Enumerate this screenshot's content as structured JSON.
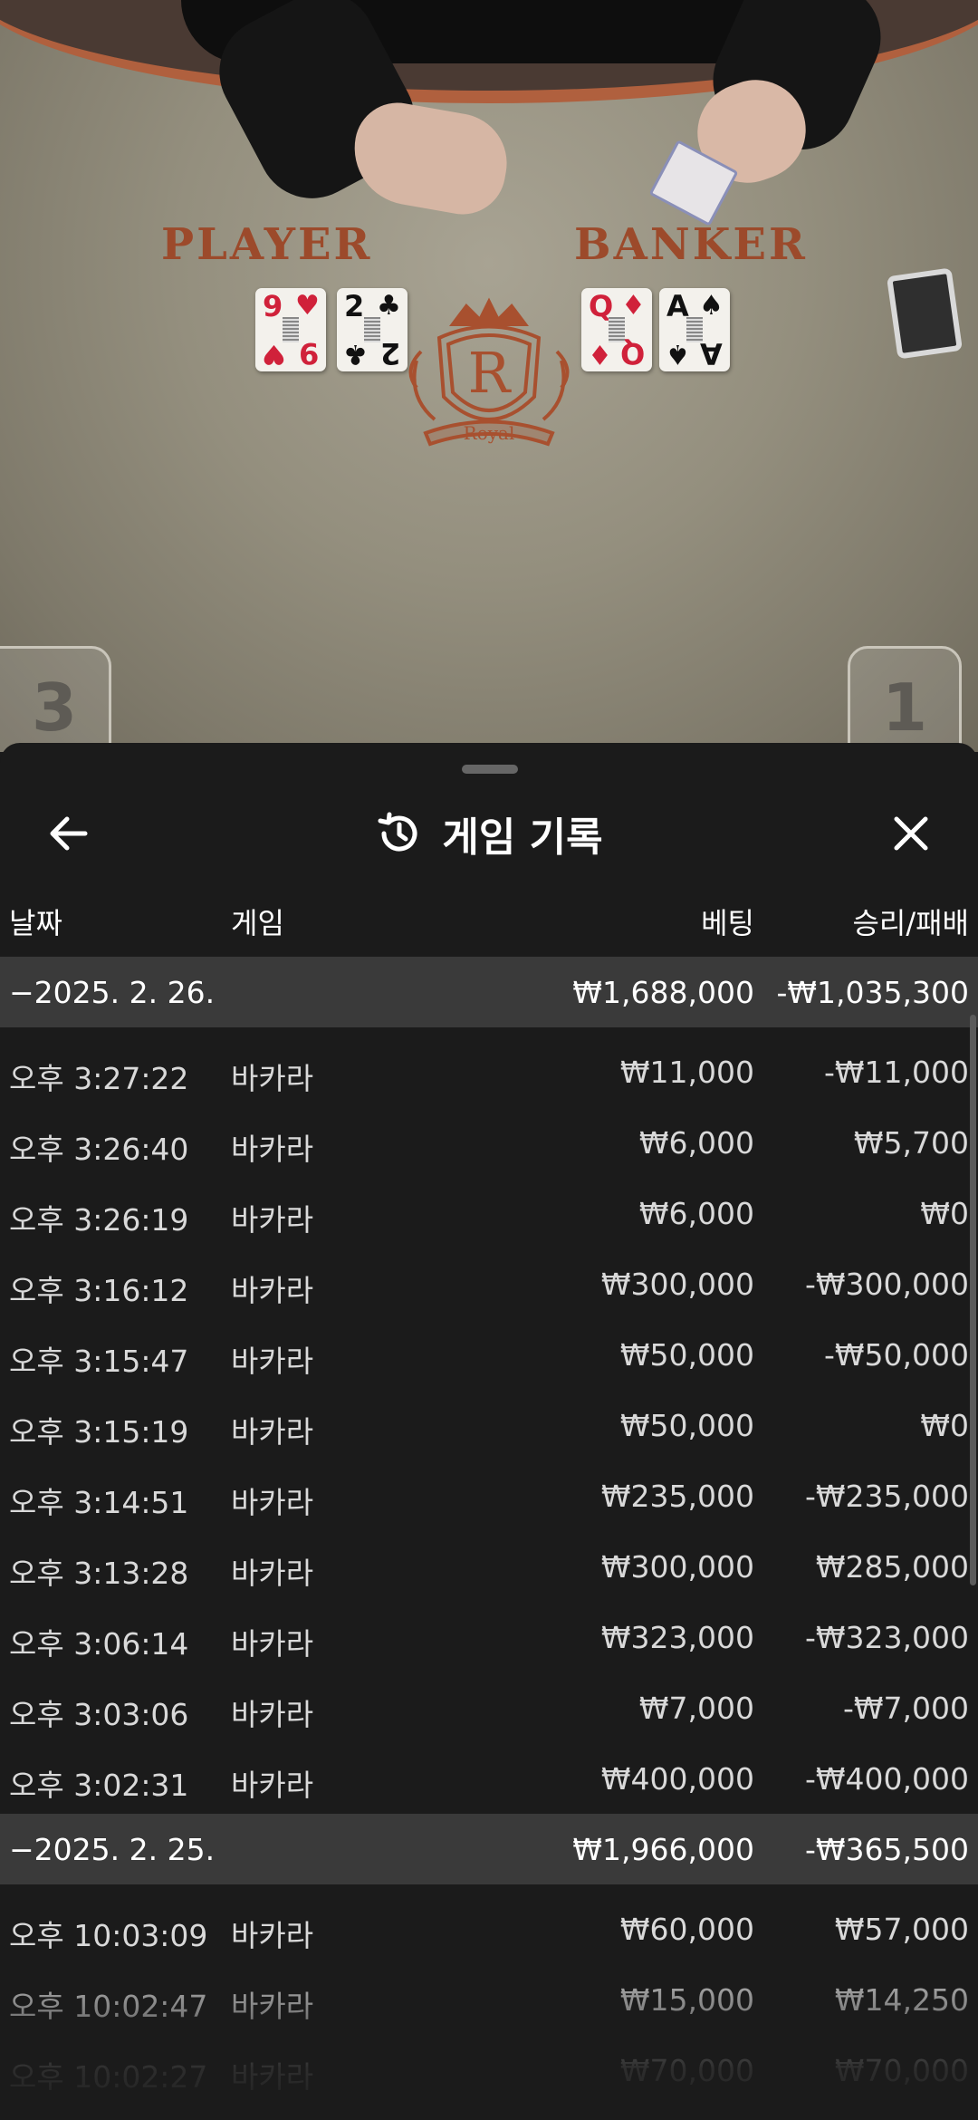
{
  "video": {
    "player_label": "PLAYER",
    "banker_label": "BANKER",
    "player_cards": [
      {
        "rank": "9",
        "suit": "♥",
        "color": "red"
      },
      {
        "rank": "2",
        "suit": "♣",
        "color": "black"
      }
    ],
    "banker_cards": [
      {
        "rank": "Q",
        "suit": "♦",
        "color": "red"
      },
      {
        "rank": "A",
        "suit": "♠",
        "color": "black"
      }
    ],
    "emblem_letter": "R",
    "emblem_text": "Royal",
    "position_left": "3",
    "position_right": "1"
  },
  "sheet": {
    "title": "게임 기록",
    "title_icon": "history-icon",
    "back_icon": "arrow-left-icon",
    "close_icon": "close-icon",
    "columns": {
      "date": "날짜",
      "game": "게임",
      "bet": "베팅",
      "result": "승리/패배"
    },
    "groups": [
      {
        "date": "−2025. 2. 26.",
        "bet": "₩1,688,000",
        "result": "-₩1,035,300",
        "rows": [
          {
            "time": "오후 3:27:22",
            "game": "바카라",
            "bet": "₩11,000",
            "result": "-₩11,000"
          },
          {
            "time": "오후 3:26:40",
            "game": "바카라",
            "bet": "₩6,000",
            "result": "₩5,700"
          },
          {
            "time": "오후 3:26:19",
            "game": "바카라",
            "bet": "₩6,000",
            "result": "₩0"
          },
          {
            "time": "오후 3:16:12",
            "game": "바카라",
            "bet": "₩300,000",
            "result": "-₩300,000"
          },
          {
            "time": "오후 3:15:47",
            "game": "바카라",
            "bet": "₩50,000",
            "result": "-₩50,000"
          },
          {
            "time": "오후 3:15:19",
            "game": "바카라",
            "bet": "₩50,000",
            "result": "₩0"
          },
          {
            "time": "오후 3:14:51",
            "game": "바카라",
            "bet": "₩235,000",
            "result": "-₩235,000"
          },
          {
            "time": "오후 3:13:28",
            "game": "바카라",
            "bet": "₩300,000",
            "result": "₩285,000"
          },
          {
            "time": "오후 3:06:14",
            "game": "바카라",
            "bet": "₩323,000",
            "result": "-₩323,000"
          },
          {
            "time": "오후 3:03:06",
            "game": "바카라",
            "bet": "₩7,000",
            "result": "-₩7,000"
          },
          {
            "time": "오후 3:02:31",
            "game": "바카라",
            "bet": "₩400,000",
            "result": "-₩400,000"
          }
        ]
      },
      {
        "date": "−2025. 2. 25.",
        "bet": "₩1,966,000",
        "result": "-₩365,500",
        "rows": [
          {
            "time": "오후 10:03:09",
            "game": "바카라",
            "bet": "₩60,000",
            "result": "₩57,000"
          },
          {
            "time": "오후 10:02:47",
            "game": "바카라",
            "bet": "₩15,000",
            "result": "₩14,250"
          },
          {
            "time": "오후 10:02:27",
            "game": "바카라",
            "bet": "₩70,000",
            "result": "₩70,000"
          }
        ]
      }
    ]
  }
}
